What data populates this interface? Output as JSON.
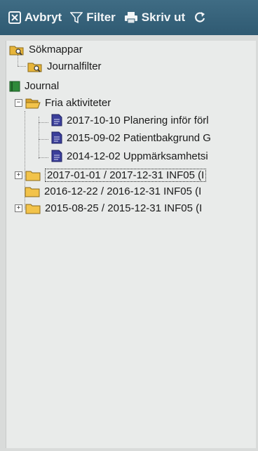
{
  "toolbar": {
    "cancel_label": "Avbryt",
    "filter_label": "Filter",
    "print_label": "Skriv ut"
  },
  "tree": {
    "search_folders": "Sökmappar",
    "journal_filter": "Journalfilter",
    "journal": "Journal",
    "free_activities": "Fria aktiviteter",
    "documents": [
      "2017-10-10 Planering inför förl",
      "2015-09-02 Patientbakgrund G",
      "2014-12-02 Uppmärksamhetsi"
    ],
    "periods": [
      "2017-01-01 / 2017-12-31 INF05 (I",
      "2016-12-22 / 2016-12-31 INF05 (I",
      "2015-08-25 / 2015-12-31 INF05 (I"
    ]
  }
}
